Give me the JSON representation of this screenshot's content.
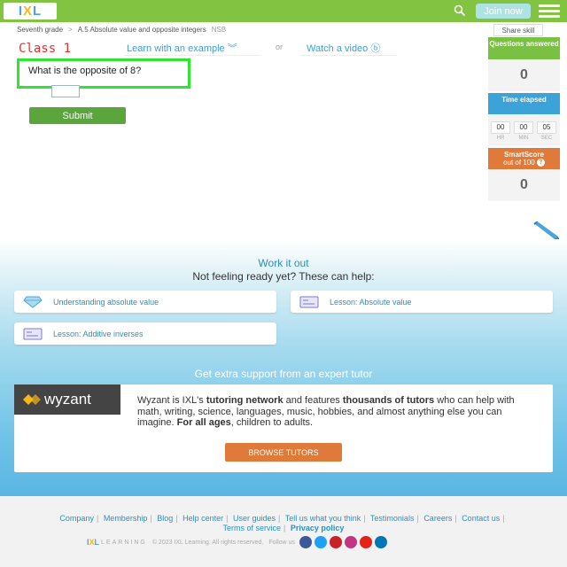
{
  "header": {
    "logo_text": [
      "I",
      "X",
      "L"
    ],
    "join_label": "Join now",
    "share_label": "Share skill"
  },
  "breadcrumb": {
    "grade": "Seventh grade",
    "separator": ">",
    "skill": "A.5 Absolute value and opposite integers",
    "code": "NSB"
  },
  "help_links": {
    "learn": "Learn with an example ︾",
    "or": "or",
    "watch": "Watch a video ⓑ"
  },
  "annotation": {
    "class_label": "Class 1"
  },
  "question": {
    "text": "What is the opposite of 8?",
    "answer_value": "",
    "submit_label": "Submit"
  },
  "stats": {
    "questions_answered_label": "Questions answered",
    "questions_answered": "0",
    "time_elapsed_label": "Time elapsed",
    "time": [
      "00",
      "00",
      "05"
    ],
    "time_units": [
      "HR",
      "MIN",
      "SEC"
    ],
    "smartscore_label": "SmartScore",
    "smartscore_sub": "out of 100",
    "smartscore_help": "?",
    "smartscore": "0"
  },
  "work": {
    "title": "Work it out",
    "subtitle": "Not feeling ready yet? These can help:",
    "cards": [
      {
        "label": "Understanding absolute value",
        "icon": "diamond-icon"
      },
      {
        "label": "Lesson: Absolute value",
        "icon": "lesson-icon"
      },
      {
        "label": "Lesson: Additive inverses",
        "icon": "lesson-icon"
      }
    ]
  },
  "tutor": {
    "title": "Get extra support from an expert tutor",
    "logo_text": "wyzant",
    "text_1": "Wyzant is IXL's ",
    "bold_1": "tutoring network",
    "text_2": " and features ",
    "bold_2": "thousands of tutors",
    "text_3": " who can help with math, writing, science, languages, music, hobbies, and almost anything else you can imagine. ",
    "bold_3": "For all ages",
    "text_4": ", children to adults.",
    "button": "BROWSE TUTORS"
  },
  "footer": {
    "links": [
      "Company",
      "Membership",
      "Blog",
      "Help center",
      "User guides",
      "Tell us what you think",
      "Testimonials",
      "Careers",
      "Contact us"
    ],
    "links2": [
      "Terms of service"
    ],
    "privacy": "Privacy policy",
    "logo_word": "LEARNING",
    "copyright": "© 2023 IXL Learning. All rights reserved.",
    "follow": "Follow us",
    "social": [
      {
        "name": "facebook-icon",
        "color": "#3b5998",
        "glyph": "f"
      },
      {
        "name": "twitter-icon",
        "color": "#1da1f2",
        "glyph": "t"
      },
      {
        "name": "pinterest-icon",
        "color": "#cb2027",
        "glyph": "p"
      },
      {
        "name": "instagram-icon",
        "color": "#c13584",
        "glyph": "◎"
      },
      {
        "name": "youtube-icon",
        "color": "#e62117",
        "glyph": "▶"
      },
      {
        "name": "linkedin-icon",
        "color": "#0077b5",
        "glyph": "in"
      }
    ]
  },
  "colors": {
    "brand_green": "#82c341",
    "annotation_box": "#2ee62e",
    "accent_blue": "#3ca3d8",
    "smartscore_orange": "#e07a3a"
  }
}
